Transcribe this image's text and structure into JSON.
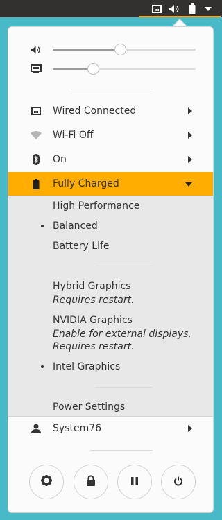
{
  "topbar": {
    "tray_icons": [
      "network-wired-icon",
      "volume-icon",
      "battery-full-icon",
      "chevron-down-icon"
    ]
  },
  "sliders": [
    {
      "name": "volume",
      "icon": "volume-icon",
      "level_fraction": 0.47
    },
    {
      "name": "brightness",
      "icon": "display-brightness-icon",
      "level_fraction": 0.28
    }
  ],
  "network": {
    "wired_label": "Wired Connected",
    "wifi_label": "Wi-Fi Off",
    "bluetooth_label": "On"
  },
  "power": {
    "battery_label": "Fully Charged",
    "profiles": [
      {
        "label": "High Performance",
        "selected": false
      },
      {
        "label": "Balanced",
        "selected": true
      },
      {
        "label": "Battery Life",
        "selected": false
      }
    ],
    "graphics": [
      {
        "label": "Hybrid Graphics",
        "note": "Requires restart.",
        "selected": false
      },
      {
        "label": "NVIDIA Graphics",
        "note": "Enable for external displays.\nRequires restart.",
        "selected": false
      },
      {
        "label": "Intel Graphics",
        "note": "",
        "selected": true
      }
    ],
    "settings_label": "Power Settings"
  },
  "user": {
    "name": "System76"
  },
  "actions": [
    "settings-gear-icon",
    "lock-icon",
    "suspend-icon",
    "power-icon"
  ],
  "colors": {
    "accent": "#faa41a",
    "active_row": "#ffad00",
    "desktop_bg": "#48b9c7",
    "topbar_bg": "#333130"
  }
}
